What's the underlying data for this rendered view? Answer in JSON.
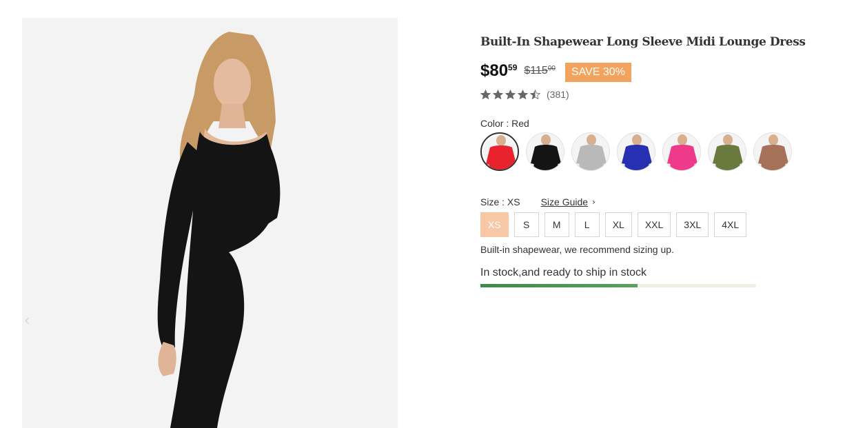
{
  "product": {
    "title": "Built-In Shapewear Long Sleeve Midi Lounge Dress",
    "price_main": "$80",
    "price_cents": "59",
    "price_old_main": "$115",
    "price_old_cents": "00",
    "save_badge": "SAVE 30%",
    "rating_stars": 4.5,
    "review_count": "(381)"
  },
  "color": {
    "label": "Color : Red",
    "options": [
      {
        "name": "Red",
        "hex": "#e8232e",
        "selected": true
      },
      {
        "name": "Black",
        "hex": "#141414",
        "selected": false
      },
      {
        "name": "Gray",
        "hex": "#b9b9b9",
        "selected": false
      },
      {
        "name": "Blue",
        "hex": "#2630b0",
        "selected": false
      },
      {
        "name": "Pink",
        "hex": "#ef3a8c",
        "selected": false
      },
      {
        "name": "Olive",
        "hex": "#6a7a3e",
        "selected": false
      },
      {
        "name": "Brown",
        "hex": "#a57259",
        "selected": false
      }
    ]
  },
  "size": {
    "label": "Size : XS",
    "guide_label": "Size Guide",
    "options": [
      "XS",
      "S",
      "M",
      "L",
      "XL",
      "XXL",
      "3XL",
      "4XL"
    ],
    "selected": "XS",
    "note": "Built-in shapewear, we recommend sizing up."
  },
  "stock": {
    "text": "In stock,and ready to ship in stock",
    "level": 0.57
  },
  "colors": {
    "accent": "#f2a35e",
    "size_selected": "#f7c7a6",
    "stock_bar": "#3f8a4a",
    "dress": "#141414"
  },
  "icons": {
    "gallery_prev": "chevron-left-icon",
    "size_guide": "chevron-right-icon",
    "star": "star-icon"
  }
}
